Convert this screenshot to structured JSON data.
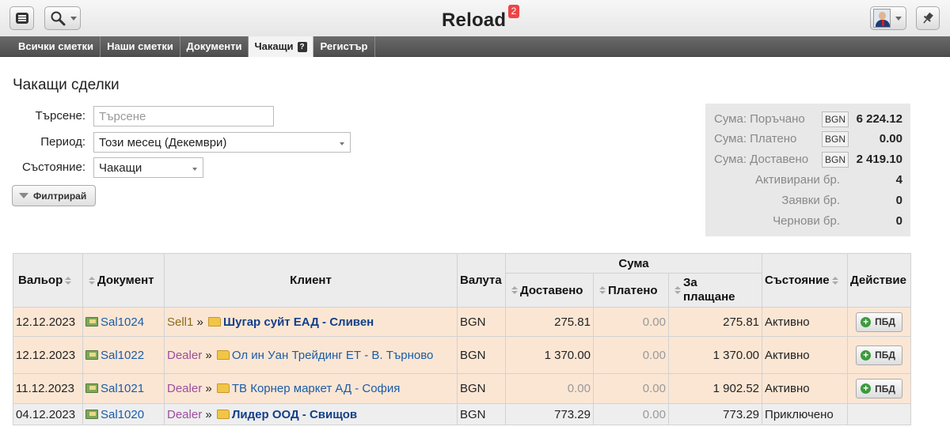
{
  "app": {
    "title": "Reload",
    "badge": "2"
  },
  "tabs": [
    {
      "label": "Всички сметки"
    },
    {
      "label": "Наши сметки"
    },
    {
      "label": "Документи"
    },
    {
      "label": "Чакащи",
      "active": true,
      "help": "?"
    },
    {
      "label": "Регистър"
    }
  ],
  "page": {
    "title": "Чакащи сделки"
  },
  "filters": {
    "search_label": "Търсене:",
    "search_placeholder": "Търсене",
    "period_label": "Период:",
    "period_value": "Този месец (Декември)",
    "state_label": "Състояние:",
    "state_value": "Чакащи",
    "filter_button": "Филтрирай"
  },
  "summary": [
    {
      "label": "Сума: Поръчано",
      "currency": "BGN",
      "value": "6 224.12"
    },
    {
      "label": "Сума: Платено",
      "currency": "BGN",
      "value": "0.00"
    },
    {
      "label": "Сума: Доставено",
      "currency": "BGN",
      "value": "2 419.10"
    },
    {
      "label": "Активирани бр.",
      "value": "4"
    },
    {
      "label": "Заявки бр.",
      "value": "0"
    },
    {
      "label": "Чернови бр.",
      "value": "0"
    }
  ],
  "table": {
    "headers": {
      "date": "Вальор",
      "document": "Документ",
      "client": "Клиент",
      "currency": "Валута",
      "amount_group": "Сума",
      "delivered": "Доставено",
      "paid": "Платено",
      "to_pay": "За плащане",
      "state": "Състояние",
      "action": "Действие"
    },
    "rows": [
      {
        "date": "12.12.2023",
        "doc": "Sal1024",
        "agent": "Sell1",
        "sep": "»",
        "client": "Шугар суйт ЕАД - Сливен",
        "currency": "BGN",
        "delivered": "275.81",
        "paid": "0.00",
        "to_pay": "275.81",
        "state": "Активно",
        "action": "ПБД"
      },
      {
        "date": "12.12.2023",
        "doc": "Sal1022",
        "agent": "Dealer",
        "sep": "»",
        "client": "Ол ин Уан Трейдинг ЕТ - В. Търново",
        "currency": "BGN",
        "delivered": "1 370.00",
        "paid": "0.00",
        "to_pay": "1 370.00",
        "state": "Активно",
        "action": "ПБД"
      },
      {
        "date": "11.12.2023",
        "doc": "Sal1021",
        "agent": "Dealer",
        "sep": "»",
        "client": "ТВ Корнер маркет АД - София",
        "currency": "BGN",
        "delivered": "0.00",
        "paid": "0.00",
        "to_pay": "1 902.52",
        "state": "Активно",
        "action": "ПБД"
      },
      {
        "date": "04.12.2023",
        "doc": "Sal1020",
        "agent": "Dealer",
        "sep": "»",
        "client": "Лидер ООД - Свищов",
        "currency": "BGN",
        "delivered": "773.29",
        "paid": "0.00",
        "to_pay": "773.29",
        "state": "Приключено",
        "action": ""
      }
    ]
  }
}
